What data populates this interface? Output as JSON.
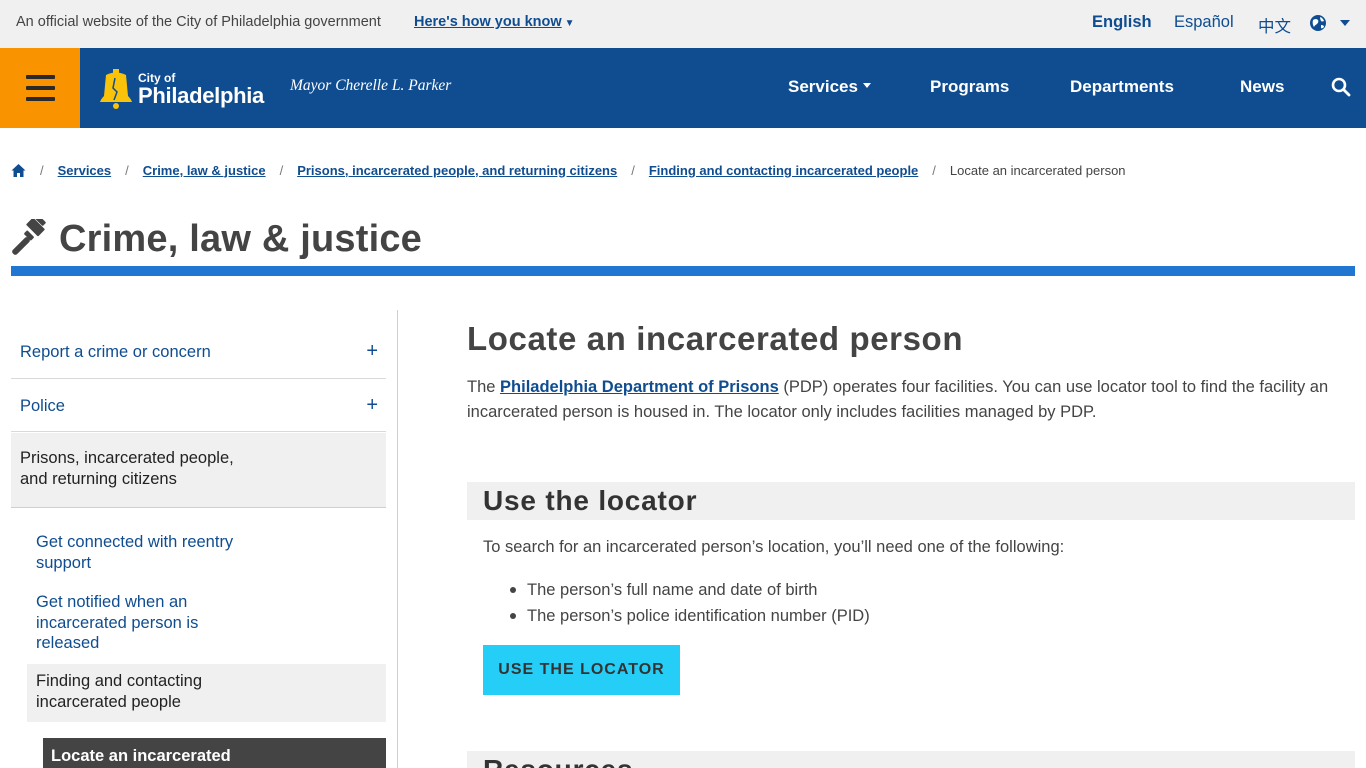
{
  "official_banner": {
    "text": "An official website of the City of Philadelphia government",
    "link": "Here's how you know"
  },
  "languages": {
    "english": "English",
    "spanish": "Español",
    "chinese": "中文"
  },
  "header": {
    "logo_small": "City of",
    "logo_big": "Philadelphia",
    "mayor": "Mayor Cherelle L. Parker",
    "nav": [
      "Services",
      "Programs",
      "Departments",
      "News"
    ],
    "colors": {
      "primary": "#0f4d90",
      "menu": "#f99300",
      "accent": "#2176d2",
      "button": "#25cef7"
    }
  },
  "breadcrumb": {
    "links": [
      "Services",
      "Crime, law & justice",
      "Prisons, incarcerated people, and returning citizens",
      "Finding and contacting incarcerated people"
    ],
    "current": "Locate an incarcerated person"
  },
  "topic": {
    "icon": "gavel-icon",
    "title": "Crime, law & justice"
  },
  "sidebar": {
    "items": [
      "Report a crime or concern",
      "Police",
      "Prisons, incarcerated people, and returning citizens"
    ],
    "sub_items": [
      "Get connected with reentry support",
      "Get notified when an incarcerated person is released",
      "Finding and contacting incarcerated people"
    ],
    "current": "Locate an incarcerated"
  },
  "main": {
    "title": "Locate an incarcerated person",
    "intro_prefix": "The ",
    "intro_link": "Philadelphia Department of Prisons",
    "intro_suffix": " (PDP) operates four facilities. You can use locator tool to find the facility an incarcerated person is housed in. The locator only includes facilities managed by PDP.",
    "section1": {
      "heading": "Use the locator",
      "body": "To search for an incarcerated person’s location, you’ll need one of the following:",
      "bullets": [
        "The person’s full name and date of birth",
        "The person’s police identification number (PID)"
      ],
      "button": "USE THE LOCATOR"
    },
    "section2": {
      "heading": "Resources"
    }
  }
}
